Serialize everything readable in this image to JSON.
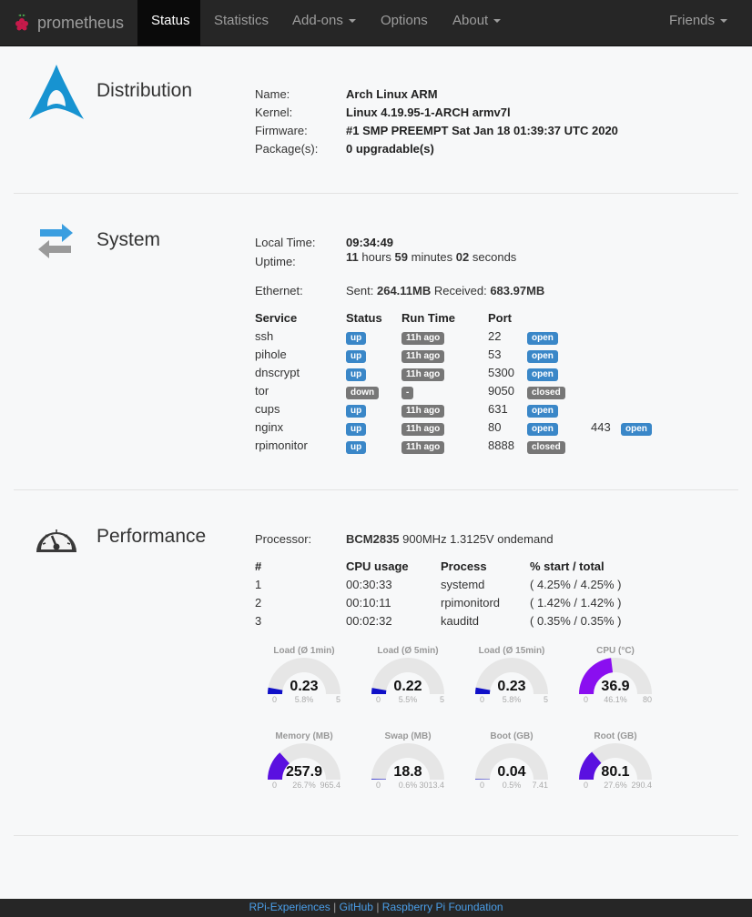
{
  "nav": {
    "brand": "prometheus",
    "items": [
      {
        "label": "Status",
        "active": true
      },
      {
        "label": "Statistics"
      },
      {
        "label": "Add-ons",
        "dropdown": true
      },
      {
        "label": "Options"
      },
      {
        "label": "About",
        "dropdown": true
      },
      {
        "label": "Friends",
        "dropdown": true
      }
    ]
  },
  "distribution": {
    "title": "Distribution",
    "rows": [
      {
        "label": "Name:",
        "value": "Arch Linux ARM"
      },
      {
        "label": "Kernel:",
        "value": "Linux 4.19.95-1-ARCH armv7l"
      },
      {
        "label": "Firmware:",
        "value": "#1 SMP PREEMPT Sat Jan 18 01:39:37 UTC 2020"
      },
      {
        "label": "Package(s):",
        "value": "0 upgradable(s)"
      }
    ]
  },
  "system": {
    "title": "System",
    "local_time_label": "Local Time:",
    "local_time": "09:34:49",
    "uptime_label": "Uptime:",
    "uptime": {
      "hours": "11",
      "hours_word": "hours",
      "minutes": "59",
      "minutes_word": "minutes",
      "seconds": "02",
      "seconds_word": "seconds"
    },
    "ethernet_label": "Ethernet:",
    "sent_label": "Sent:",
    "sent": "264.11MB",
    "received_label": "Received:",
    "received": "683.97MB",
    "services_headers": [
      "Service",
      "Status",
      "Run Time",
      "Port"
    ],
    "services": [
      {
        "name": "ssh",
        "status": "up",
        "runtime": "11h ago",
        "port": "22",
        "port_state": "open"
      },
      {
        "name": "pihole",
        "status": "up",
        "runtime": "11h ago",
        "port": "53",
        "port_state": "open"
      },
      {
        "name": "dnscrypt",
        "status": "up",
        "runtime": "11h ago",
        "port": "5300",
        "port_state": "open"
      },
      {
        "name": "tor",
        "status": "down",
        "runtime": "-",
        "port": "9050",
        "port_state": "closed"
      },
      {
        "name": "cups",
        "status": "up",
        "runtime": "11h ago",
        "port": "631",
        "port_state": "open"
      },
      {
        "name": "nginx",
        "status": "up",
        "runtime": "11h ago",
        "port": "80",
        "port_state": "open",
        "port2": "443",
        "port2_state": "open"
      },
      {
        "name": "rpimonitor",
        "status": "up",
        "runtime": "11h ago",
        "port": "8888",
        "port_state": "closed"
      }
    ]
  },
  "performance": {
    "title": "Performance",
    "processor_label": "Processor:",
    "processor_name": "BCM2835",
    "processor_detail": "900MHz 1.3125V ondemand",
    "proc_headers": [
      "#",
      "CPU usage",
      "Process",
      "% start / total"
    ],
    "processes": [
      {
        "n": "1",
        "cpu": "00:30:33",
        "name": "systemd",
        "pct": "( 4.25% / 4.25% )"
      },
      {
        "n": "2",
        "cpu": "00:10:11",
        "name": "rpimonitord",
        "pct": "( 1.42% / 1.42% )"
      },
      {
        "n": "3",
        "cpu": "00:02:32",
        "name": "kauditd",
        "pct": "( 0.35% / 0.35% )"
      }
    ],
    "gauges": [
      {
        "title": "Load (Ø 1min)",
        "value": "0.23",
        "fraction": 0.058,
        "min": "0",
        "pct": "5.8%",
        "max": "5",
        "color": "#1010c8"
      },
      {
        "title": "Load (Ø 5min)",
        "value": "0.22",
        "fraction": 0.055,
        "min": "0",
        "pct": "5.5%",
        "max": "5",
        "color": "#1010c8"
      },
      {
        "title": "Load (Ø 15min)",
        "value": "0.23",
        "fraction": 0.058,
        "min": "0",
        "pct": "5.8%",
        "max": "5",
        "color": "#1010c8"
      },
      {
        "title": "CPU (°C)",
        "value": "36.9",
        "fraction": 0.461,
        "min": "0",
        "pct": "46.1%",
        "max": "80",
        "color": "#8a0ff0"
      },
      {
        "title": "Memory (MB)",
        "value": "257.9",
        "fraction": 0.267,
        "min": "0",
        "pct": "26.7%",
        "max": "965.4",
        "color": "#5a10e0"
      },
      {
        "title": "Swap (MB)",
        "value": "18.8",
        "fraction": 0.006,
        "min": "0",
        "pct": "0.6%",
        "max": "3013.4",
        "color": "#1010c8"
      },
      {
        "title": "Boot (GB)",
        "value": "0.04",
        "fraction": 0.005,
        "min": "0",
        "pct": "0.5%",
        "max": "7.41",
        "color": "#1010c8"
      },
      {
        "title": "Root (GB)",
        "value": "80.1",
        "fraction": 0.276,
        "min": "0",
        "pct": "27.6%",
        "max": "290.4",
        "color": "#5a10e0"
      }
    ]
  },
  "footer": {
    "link1": "RPi-Experiences",
    "sep": "|",
    "link2": "GitHub",
    "link3": "Raspberry Pi Foundation"
  }
}
